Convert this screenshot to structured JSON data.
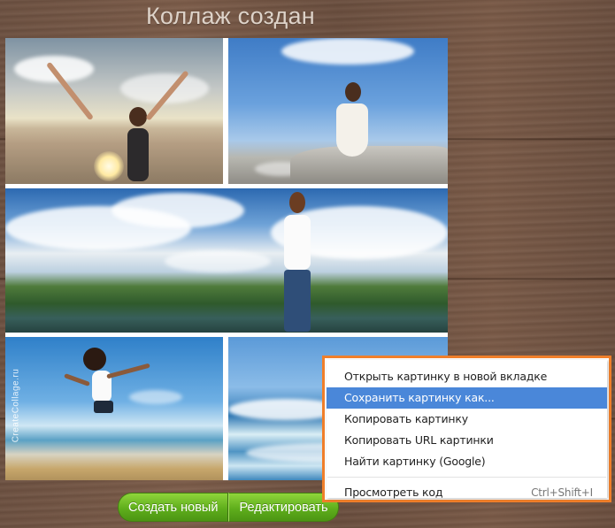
{
  "page": {
    "title": "Коллаж создан"
  },
  "collage": {
    "watermark": "CreateCollage.ru",
    "photos": [
      "beach-sunset-photo",
      "rock-sky-photo",
      "lake-panorama-photo",
      "beach-jump-photo",
      "sea-waves-photo"
    ]
  },
  "buttons": {
    "create_new": "Создать новый",
    "edit": "Редактировать"
  },
  "context_menu": {
    "items": [
      "Открыть картинку в новой вкладке",
      "Сохранить картинку как...",
      "Копировать картинку",
      "Копировать URL картинки",
      "Найти картинку (Google)"
    ],
    "inspect": "Просмотреть код",
    "inspect_shortcut": "Ctrl+Shift+I",
    "selected_index": 1,
    "highlight_color": "#f07f2a"
  },
  "colors": {
    "button_green": "#5fae1c",
    "menu_selection": "#4a87d9",
    "wood": "#6d5141"
  }
}
